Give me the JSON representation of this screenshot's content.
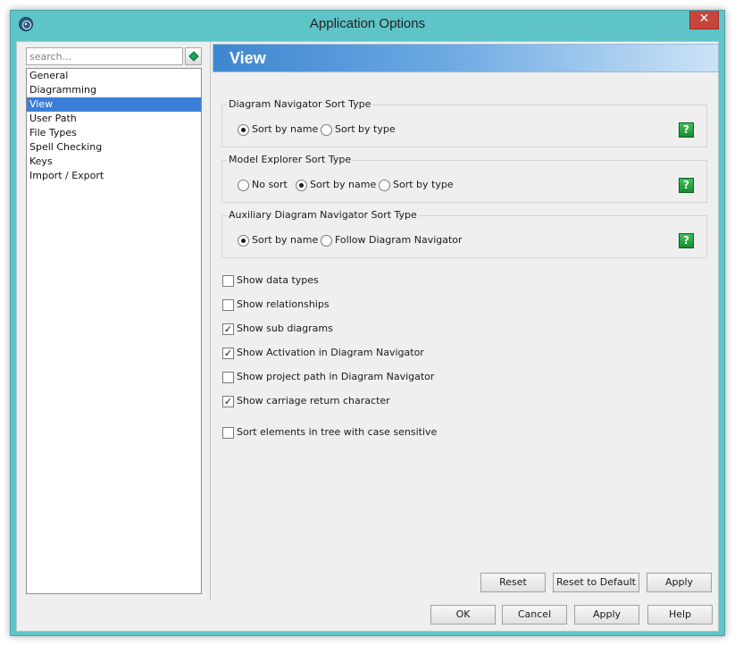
{
  "window": {
    "title": "Application Options",
    "close_glyph": "✕"
  },
  "sidebar": {
    "search_placeholder": "search...",
    "items": [
      {
        "label": "General"
      },
      {
        "label": "Diagramming"
      },
      {
        "label": "View",
        "selected": true
      },
      {
        "label": "User Path"
      },
      {
        "label": "File Types"
      },
      {
        "label": "Spell Checking"
      },
      {
        "label": "Keys"
      },
      {
        "label": "Import / Export"
      }
    ]
  },
  "view": {
    "header": "View",
    "groups": [
      {
        "legend": "Diagram Navigator Sort Type",
        "options": [
          "Sort by name",
          "Sort by type"
        ],
        "selected": "Sort by name"
      },
      {
        "legend": "Model Explorer Sort Type",
        "options": [
          "No sort",
          "Sort by name",
          "Sort by type"
        ],
        "selected": "Sort by name"
      },
      {
        "legend": "Auxiliary Diagram Navigator Sort Type",
        "options": [
          "Sort by name",
          "Follow Diagram Navigator"
        ],
        "selected": "Sort by name"
      }
    ],
    "help_glyph": "?",
    "checkboxes": [
      {
        "label": "Show data types",
        "checked": false
      },
      {
        "label": "Show relationships",
        "checked": false
      },
      {
        "label": "Show sub diagrams",
        "checked": true
      },
      {
        "label": "Show Activation in Diagram Navigator",
        "checked": true
      },
      {
        "label": "Show project path in Diagram Navigator",
        "checked": false
      },
      {
        "label": "Show carriage return character",
        "checked": true
      },
      {
        "label": "Sort elements in tree with case sensitive",
        "checked": false
      }
    ],
    "panel_buttons": {
      "reset": "Reset",
      "reset_default": "Reset to Default",
      "apply": "Apply"
    }
  },
  "footer_buttons": {
    "ok": "OK",
    "cancel": "Cancel",
    "apply": "Apply",
    "help": "Help"
  },
  "colors": {
    "titlebar": "#5fc4c8",
    "selection": "#3b7ed8",
    "header_start": "#3e86d0",
    "help_green": "#1b8b35",
    "close_red": "#c7453a"
  }
}
